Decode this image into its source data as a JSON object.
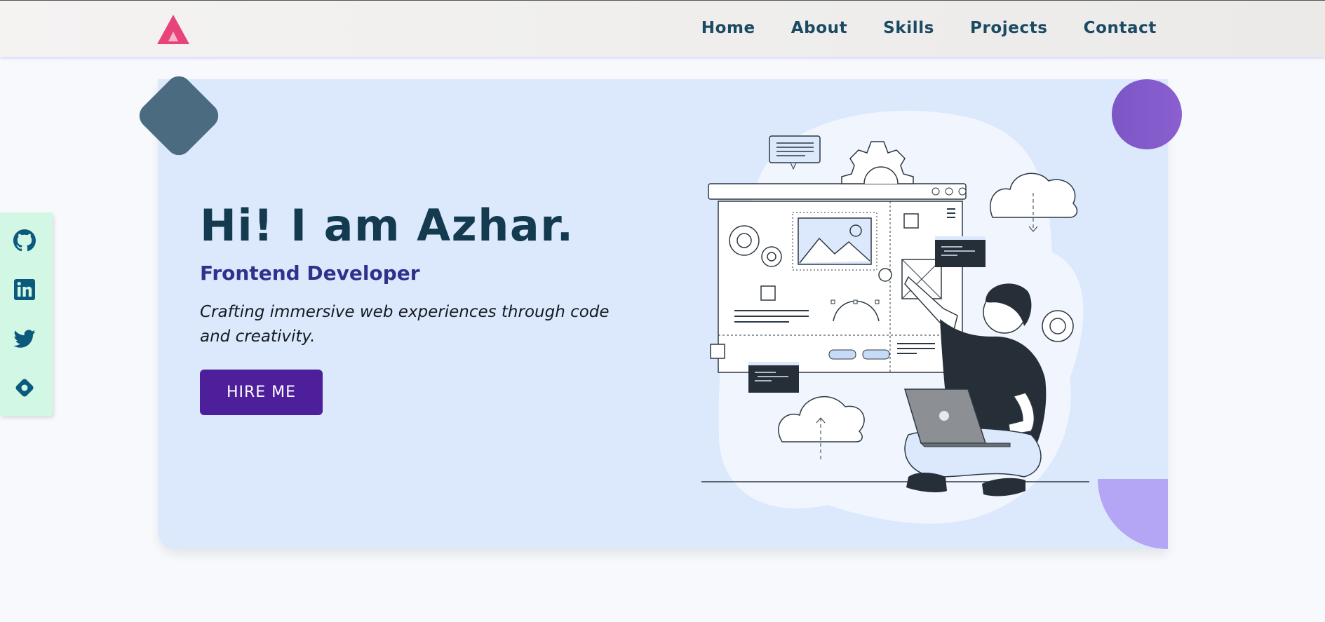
{
  "nav": {
    "logo": "triangle-logo-icon",
    "links": [
      "Home",
      "About",
      "Skills",
      "Projects",
      "Contact"
    ]
  },
  "social": {
    "icons": [
      "github-icon",
      "linkedin-icon",
      "twitter-icon",
      "portfolio-icon"
    ]
  },
  "hero": {
    "title": "Hi! I am Azhar.",
    "subtitle": "Frontend Developer",
    "tagline": "Crafting immersive web experiences through code and creativity.",
    "cta_label": "HIRE ME"
  },
  "colors": {
    "accent": "#4d1f9a",
    "logo": "#e8437b",
    "card_background": "#dce9fd",
    "social_bar": "#d2f7e4",
    "nav_text": "#1b4a62"
  }
}
